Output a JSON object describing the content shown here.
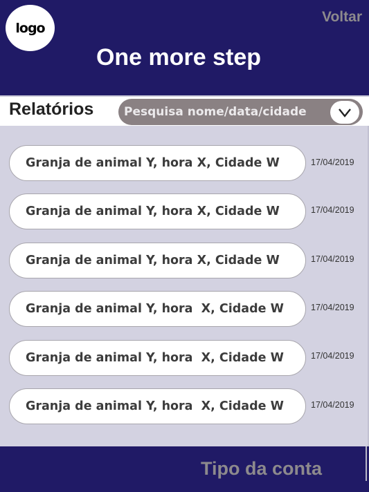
{
  "header": {
    "logo_text": "logo",
    "back_label": "Voltar",
    "title": "One more step"
  },
  "toolbar": {
    "section_title": "Relatórios",
    "search": {
      "placeholder": "Pesquisa nome/data/cidade"
    },
    "dropdown_icon": "chevron-down-icon"
  },
  "reports": [
    {
      "label": "Granja de animal Y, hora X, Cidade W",
      "date": "17/04/2019"
    },
    {
      "label": "Granja de animal Y, hora X, Cidade W",
      "date": "17/04/2019"
    },
    {
      "label": "Granja de animal Y, hora X, Cidade W",
      "date": "17/04/2019"
    },
    {
      "label": "Granja de animal Y, hora  X, Cidade W",
      "date": "17/04/2019"
    },
    {
      "label": "Granja de animal Y, hora  X, Cidade W",
      "date": "17/04/2019"
    },
    {
      "label": "Granja de animal Y, hora  X, Cidade W",
      "date": "17/04/2019"
    }
  ],
  "footer": {
    "account_label": "Tipo da conta"
  },
  "colors": {
    "primary": "#201a66",
    "list_background": "#d3d2e1",
    "search_background": "#8a8183",
    "muted_text": "#8d8a8d"
  }
}
